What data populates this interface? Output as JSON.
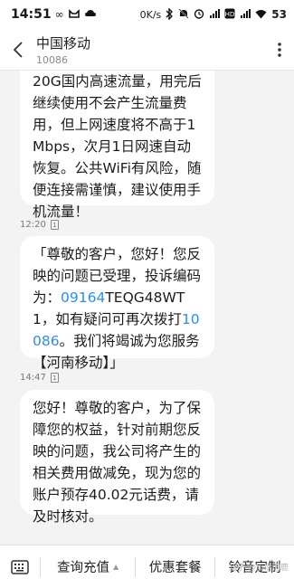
{
  "status_bar": {
    "time": "14:51",
    "left_icons": [
      "infinity-icon",
      "cat-icon",
      "cloud-icon"
    ],
    "data_speed": "0K/s",
    "battery_level": "53",
    "right_icons": [
      "bluetooth-icon",
      "mute-icon",
      "alarm-icon",
      "signal-icon",
      "hd-icon",
      "signal-icon",
      "wifi-icon"
    ]
  },
  "header": {
    "title": "中国移动",
    "subtitle": "10086"
  },
  "messages": [
    {
      "text_parts": [
        "20G国内高速流量，用完后继续使用不会产生流量费用，但上网速度将不高于1Mbps，次月1日网速自动恢复。公共WiFi有风险，随便连接需谨慎，建议使用手机流量！"
      ]
    },
    {
      "timestamp": "12:20",
      "sim": "1",
      "text_before": "「尊敬的客户，您好！您反映的问题已受理，投诉编码为：",
      "code_link": "09164",
      "text_mid": "TEQG48WT1，如有疑问可再次拨打",
      "phone_link": "10086",
      "text_after": "。我们将竭诚为您服务【河南移动】」"
    },
    {
      "timestamp": "14:47",
      "sim": "1",
      "text": "您好！尊敬的客户，为了保障您的权益，针对前期您反映的问题，我公司将产生的相关费用做减免，现为您的账户预存40.02元话费，请及时核对。"
    }
  ],
  "bottom_bar": {
    "menu1": "查询充值",
    "menu2": "优惠套餐",
    "menu3": "铃音定制"
  },
  "watermark": "知乎 @雨瑞的鹿",
  "colors": {
    "link": "#2e8fe6",
    "background": "#f3f3f3",
    "bubble": "#ffffff"
  }
}
